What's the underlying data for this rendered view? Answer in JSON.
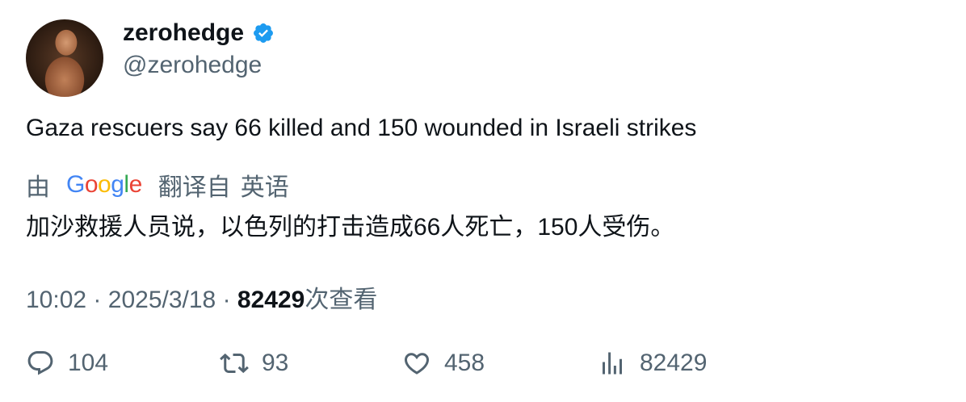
{
  "author": {
    "name": "zerohedge",
    "handle": "@zerohedge",
    "verified_color": "#1d9bf0"
  },
  "tweet": {
    "text": "Gaza rescuers say 66 killed and 150 wounded in Israeli strikes"
  },
  "translation": {
    "by_label": "由",
    "google_letters": [
      "G",
      "o",
      "o",
      "g",
      "l",
      "e"
    ],
    "translated_from": "翻译自",
    "language": "英语",
    "text": "加沙救援人员说，以色列的打击造成66人死亡，150人受伤。"
  },
  "meta": {
    "time": "10:02",
    "separator": "·",
    "date": "2025/3/18",
    "views_count": "82429",
    "views_label": "次查看"
  },
  "actions": {
    "replies": "104",
    "retweets": "93",
    "likes": "458",
    "views": "82429"
  },
  "icons": [
    "verified-badge-icon",
    "reply-icon",
    "retweet-icon",
    "like-icon",
    "views-icon"
  ]
}
